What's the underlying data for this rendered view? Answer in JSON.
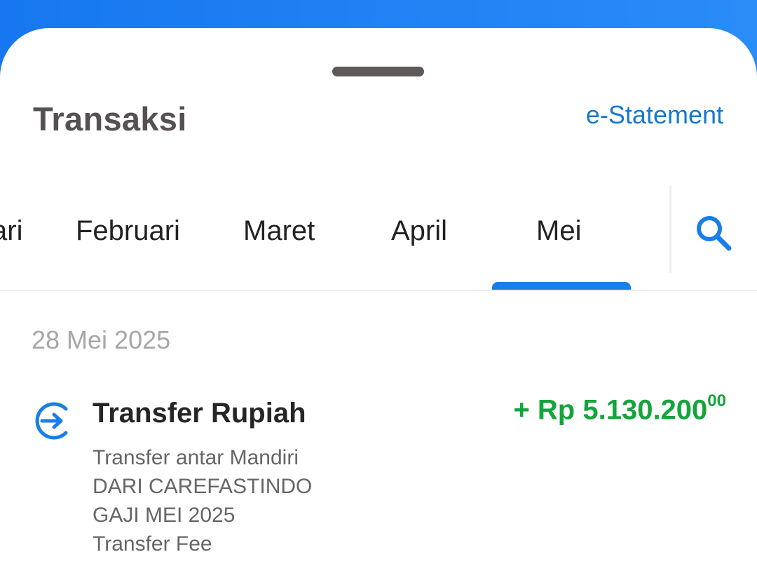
{
  "header": {
    "title": "Transaksi",
    "estatement_label": "e-Statement"
  },
  "tabs": [
    {
      "label": "Januari",
      "visible_text": "ari",
      "selected": false
    },
    {
      "label": "Februari",
      "selected": false
    },
    {
      "label": "Maret",
      "selected": false
    },
    {
      "label": "April",
      "selected": false
    },
    {
      "label": "Mei",
      "selected": true
    }
  ],
  "search": {
    "icon": "search-icon"
  },
  "transactions": [
    {
      "date": "28 Mei 2025",
      "title": "Transfer Rupiah",
      "amount_main": "+ Rp 5.130.200",
      "amount_cents": "00",
      "description_lines": [
        "Transfer antar Mandiri",
        "DARI CAREFASTINDO",
        "GAJI MEI 2025",
        "Transfer Fee"
      ],
      "icon": "transfer-in-icon"
    }
  ],
  "colors": {
    "accent": "#1a7ee9",
    "link": "#1678cf",
    "positive": "#13a53c",
    "header_bg": "#1677f0"
  }
}
